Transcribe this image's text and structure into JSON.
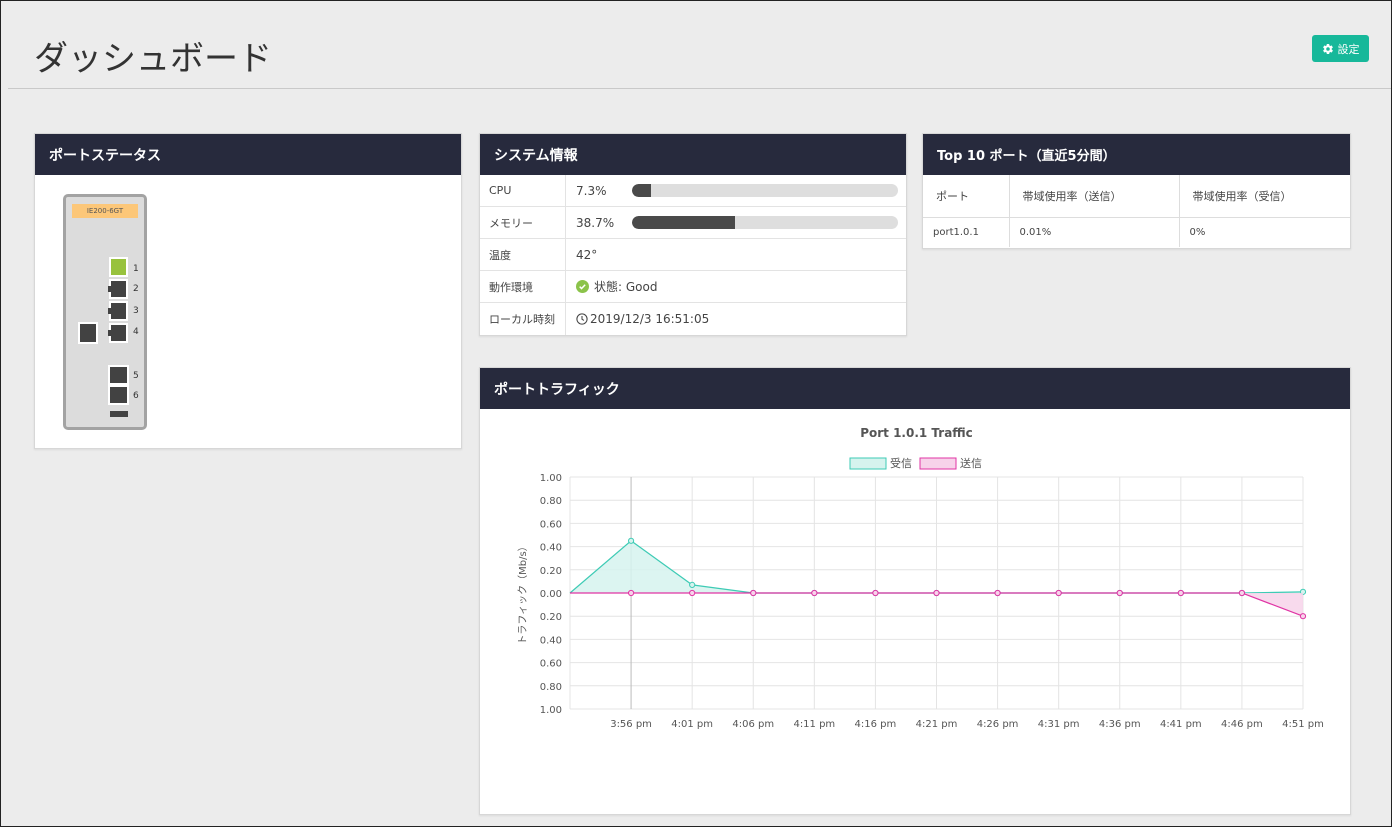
{
  "header": {
    "title": "ダッシュボード",
    "settings_label": "設定"
  },
  "port_status": {
    "title": "ポートステータス",
    "device_model": "IE200-6GT",
    "ports": [
      {
        "num": "1",
        "state": "up"
      },
      {
        "num": "2",
        "state": "down"
      },
      {
        "num": "3",
        "state": "down"
      },
      {
        "num": "4",
        "state": "down"
      },
      {
        "num": "5",
        "state": "down"
      },
      {
        "num": "6",
        "state": "down"
      }
    ]
  },
  "system_info": {
    "title": "システム情報",
    "rows": [
      {
        "key": "CPU",
        "value": "7.3%",
        "bar": 0.073
      },
      {
        "key": "メモリー",
        "value": "38.7%",
        "bar": 0.387
      },
      {
        "key": "温度",
        "value": "42°"
      },
      {
        "key": "動作環境",
        "value": "状態: Good",
        "status_color": "#8bc34a"
      },
      {
        "key": "ローカル時刻",
        "value": "2019/12/3 16:51:05"
      }
    ]
  },
  "top_ports": {
    "title": "Top 10 ポート（直近5分間）",
    "columns": [
      "ポート",
      "帯域使用率（送信）",
      "帯域使用率（受信）"
    ],
    "rows": [
      [
        "port1.0.1",
        "0.01%",
        "0%"
      ]
    ]
  },
  "traffic": {
    "title": "ポートトラフィック"
  },
  "chart_data": {
    "type": "area",
    "title": "Port 1.0.1 Traffic",
    "xlabel": "",
    "ylabel": "トラフィック（Mb/s）",
    "ylim": [
      -1.0,
      1.0
    ],
    "y_ticks": [
      "1.00",
      "0.80",
      "0.60",
      "0.40",
      "0.20",
      "0.00",
      "0.20",
      "0.40",
      "0.60",
      "0.80",
      "1.00"
    ],
    "x_ticks": [
      "3:56 pm",
      "4:01 pm",
      "4:06 pm",
      "4:11 pm",
      "4:16 pm",
      "4:21 pm",
      "4:26 pm",
      "4:31 pm",
      "4:36 pm",
      "4:41 pm",
      "4:46 pm",
      "4:51 pm"
    ],
    "x_minutes": [
      -5,
      0,
      5,
      10,
      15,
      20,
      25,
      30,
      35,
      40,
      45,
      50,
      55
    ],
    "grid": true,
    "legend": "top",
    "series": [
      {
        "name": "受信",
        "color": "#3ecbb5",
        "fill": "#d6f3ee",
        "values": [
          0,
          0.45,
          0.07,
          0,
          0,
          0,
          0,
          0,
          0,
          0,
          0,
          0,
          0.01
        ]
      },
      {
        "name": "送信",
        "color": "#e034a4",
        "fill": "#f7d3ea",
        "values": [
          0,
          0,
          0,
          0,
          0,
          0,
          0,
          0,
          0,
          0,
          0,
          0,
          -0.2
        ]
      }
    ]
  }
}
